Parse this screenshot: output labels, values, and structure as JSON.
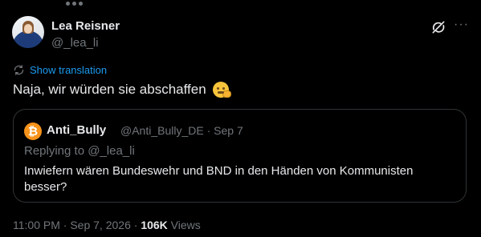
{
  "tweet": {
    "author_name": "Lea Reisner",
    "author_handle": "@_lea_li",
    "translate_label": "Show translation",
    "text": "Naja, wir würden sie abschaffen"
  },
  "quoted": {
    "author_name": "Anti_Bully",
    "author_handle": "@Anti_Bully_DE",
    "separator": "·",
    "date": "Sep 7",
    "replying_to": "Replying to @_lea_li",
    "text": "Inwiefern wären Bundeswehr und BND in den Händen von Kommunisten besser?"
  },
  "meta": {
    "time": "11:00 PM",
    "dot1": "·",
    "date": "Sep 7, 2026",
    "dot2": "·",
    "views_count": "106K",
    "views_label": "Views"
  },
  "icons": {
    "grok": "grok-icon",
    "more": "more-icon",
    "translate": "translate-icon",
    "emoji": "melting-face-emoji-icon",
    "quoted_avatar": "bitcoin-avatar-icon"
  },
  "colors": {
    "background": "#000000",
    "text": "#e7e9ea",
    "muted": "#71767b",
    "link": "#1d9bf0",
    "border": "#2f3336",
    "bitcoin": "#f7931a"
  }
}
